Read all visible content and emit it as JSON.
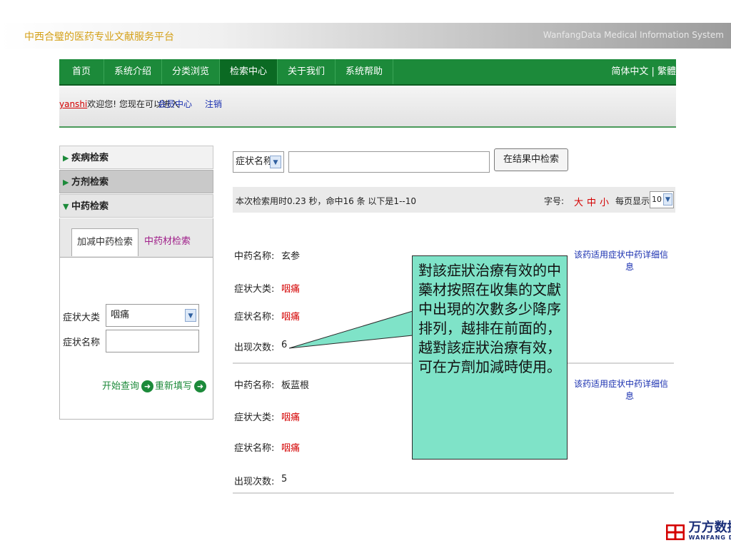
{
  "banner": {
    "title": "中西合璧的医药专业文献服务平台",
    "subtitle_en": "WanfangData Medical Information System"
  },
  "nav": {
    "items": [
      "首页",
      "系统介绍",
      "分类浏览",
      "检索中心",
      "关于我们",
      "系统帮助"
    ],
    "active": "检索中心",
    "lang": "简体中文 | 繁體"
  },
  "userbar": {
    "user": "yanshi",
    "welcome": "欢迎您!",
    "text": "您现在可以进入",
    "member_link": "会员中心",
    "logout_link": "注销"
  },
  "sidebar": {
    "sections": [
      "疾病检索",
      "方剂检索",
      "中药检索"
    ],
    "tabs": [
      "加减中药检索",
      "中药材检索"
    ],
    "label_major": "症状大类",
    "major_value": "咽痛",
    "label_name": "症状名称",
    "name_value": "",
    "search_btn": "开始查询",
    "reset_btn": "重新填写"
  },
  "search": {
    "field_select": "症状名称",
    "query_value": "",
    "button": "在结果中检索"
  },
  "stats": {
    "text": "本次检索用时0.23 秒，命中16 条 以下是1--10",
    "font_label": "字号:",
    "sizes": [
      "大",
      "中",
      "小"
    ],
    "perpage_label": "每页显示",
    "perpage_value": "10"
  },
  "results": [
    {
      "name_label": "中药名称:",
      "name": "玄参",
      "cat_label": "症状大类:",
      "cat": "咽痛",
      "sym_label": "症状名称:",
      "sym": "咽痛",
      "count_label": "出现次数:",
      "count": "6",
      "link1": "该药适用症状",
      "link2": "中药详细信息"
    },
    {
      "name_label": "中药名称:",
      "name": "板蓝根",
      "cat_label": "症状大类:",
      "cat": "咽痛",
      "sym_label": "症状名称:",
      "sym": "咽痛",
      "count_label": "出现次数:",
      "count": "5",
      "link1": "该药适用症状",
      "link2": "中药详细信息"
    }
  ],
  "callout": {
    "text": "對該症狀治療有效的中藥材按照在收集的文獻中出現的次數多少降序排列，越排在前面的，越對該症狀治療有效，可在方劑加減時使用。"
  },
  "logo": {
    "cn": "万方数据",
    "en": "WANFANG DATA"
  },
  "colors": {
    "nav_green": "#1c8a3a",
    "callout_bg": "#7fe3c8",
    "highlight_red": "#d40000",
    "link_blue": "#1a30b0"
  }
}
